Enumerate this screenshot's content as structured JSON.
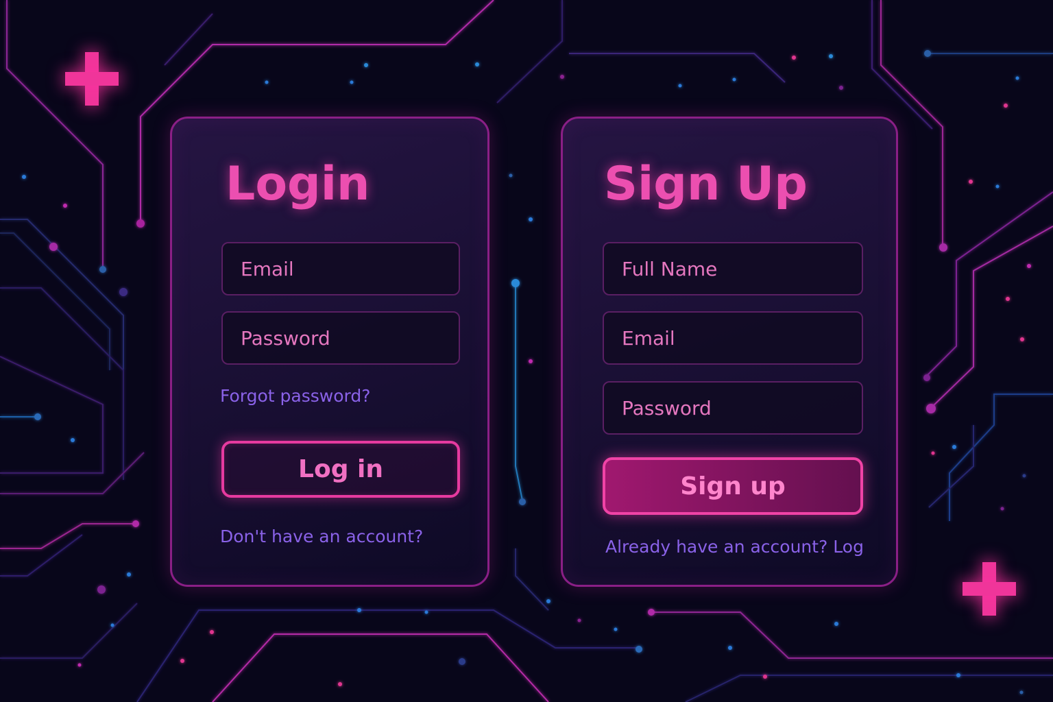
{
  "colors": {
    "background": "#08061a",
    "accent_pink": "#ec4fb0",
    "link_purple": "#8a62e8",
    "card_border": "#8a1f86"
  },
  "decorations": {
    "top_left_icon": "plus-icon",
    "bottom_right_icon": "plus-icon"
  },
  "login": {
    "title": "Login",
    "email_placeholder": "Email",
    "password_placeholder": "Password",
    "forgot_password": "Forgot password?",
    "submit_label": "Log in",
    "signup_prompt": "Don't have an account?"
  },
  "signup": {
    "title": "Sign Up",
    "fullname_placeholder": "Full Name",
    "email_placeholder": "Email",
    "password_placeholder": "Password",
    "submit_label": "Sign up",
    "login_prompt": "Already have an account? Log"
  }
}
